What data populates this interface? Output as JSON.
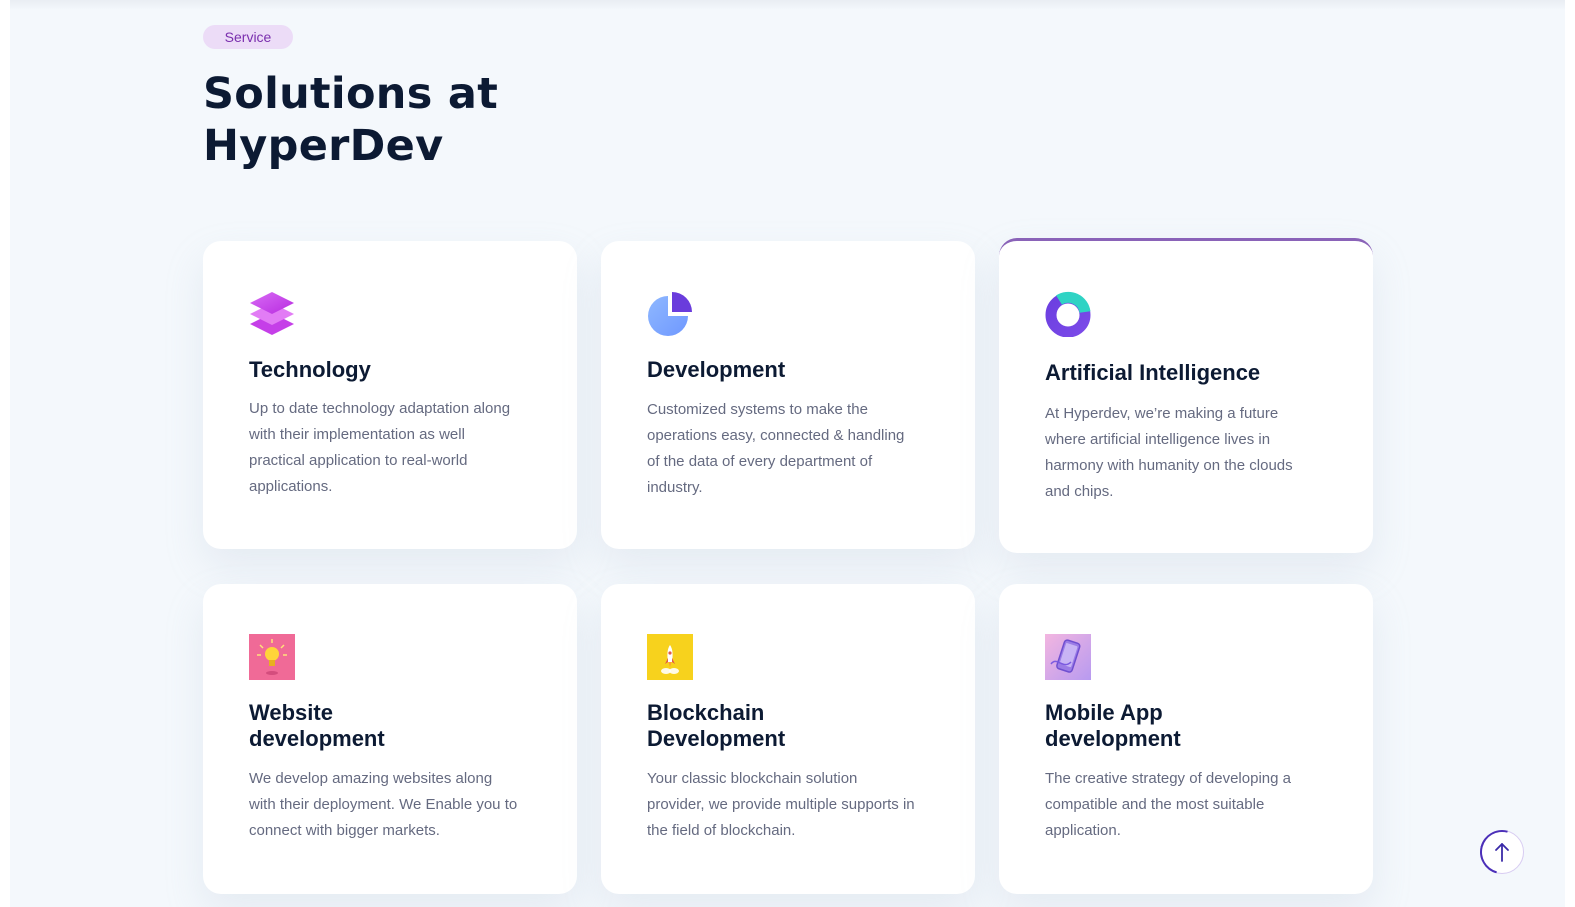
{
  "section": {
    "badge": "Service",
    "title_line1": "Solutions at",
    "title_line2": "HyperDev"
  },
  "cards": [
    {
      "title": "Technology",
      "description": "Up to date technology adaptation along with their implementation as well practical application to real-world applications.",
      "icon": "stacked-layers-icon"
    },
    {
      "title": "Development",
      "description": "Customized systems to make the operations easy, connected & handling of the data of every department of industry.",
      "icon": "pie-chart-icon"
    },
    {
      "title": "Artificial Intelligence",
      "description": "At Hyperdev, we’re making a future where artificial intelligence lives in harmony with humanity on the clouds and chips.",
      "icon": "ring-icon",
      "accent": "#8a63b8"
    },
    {
      "title_line1": "Website",
      "title_line2": "development",
      "description": "We develop amazing websites along with their deployment. We Enable you to connect with bigger markets.",
      "icon": "lightbulb-icon"
    },
    {
      "title_line1": "Blockchain",
      "title_line2": "Development",
      "description": "Your classic blockchain solution provider, we provide multiple supports in the field of blockchain.",
      "icon": "rocket-icon"
    },
    {
      "title_line1": "Mobile App",
      "title_line2": "development",
      "description": "The creative strategy of developing a compatible and the most suitable application.",
      "icon": "mobile-phone-icon"
    }
  ],
  "scroll_top": {
    "icon": "arrow-up-icon"
  },
  "colors": {
    "page_bg": "#f4f8fc",
    "title": "#0c1a33",
    "body_text": "#656a80",
    "badge_bg": "#ecdcf7",
    "badge_text": "#7a2fae",
    "accent": "#8a63b8"
  }
}
